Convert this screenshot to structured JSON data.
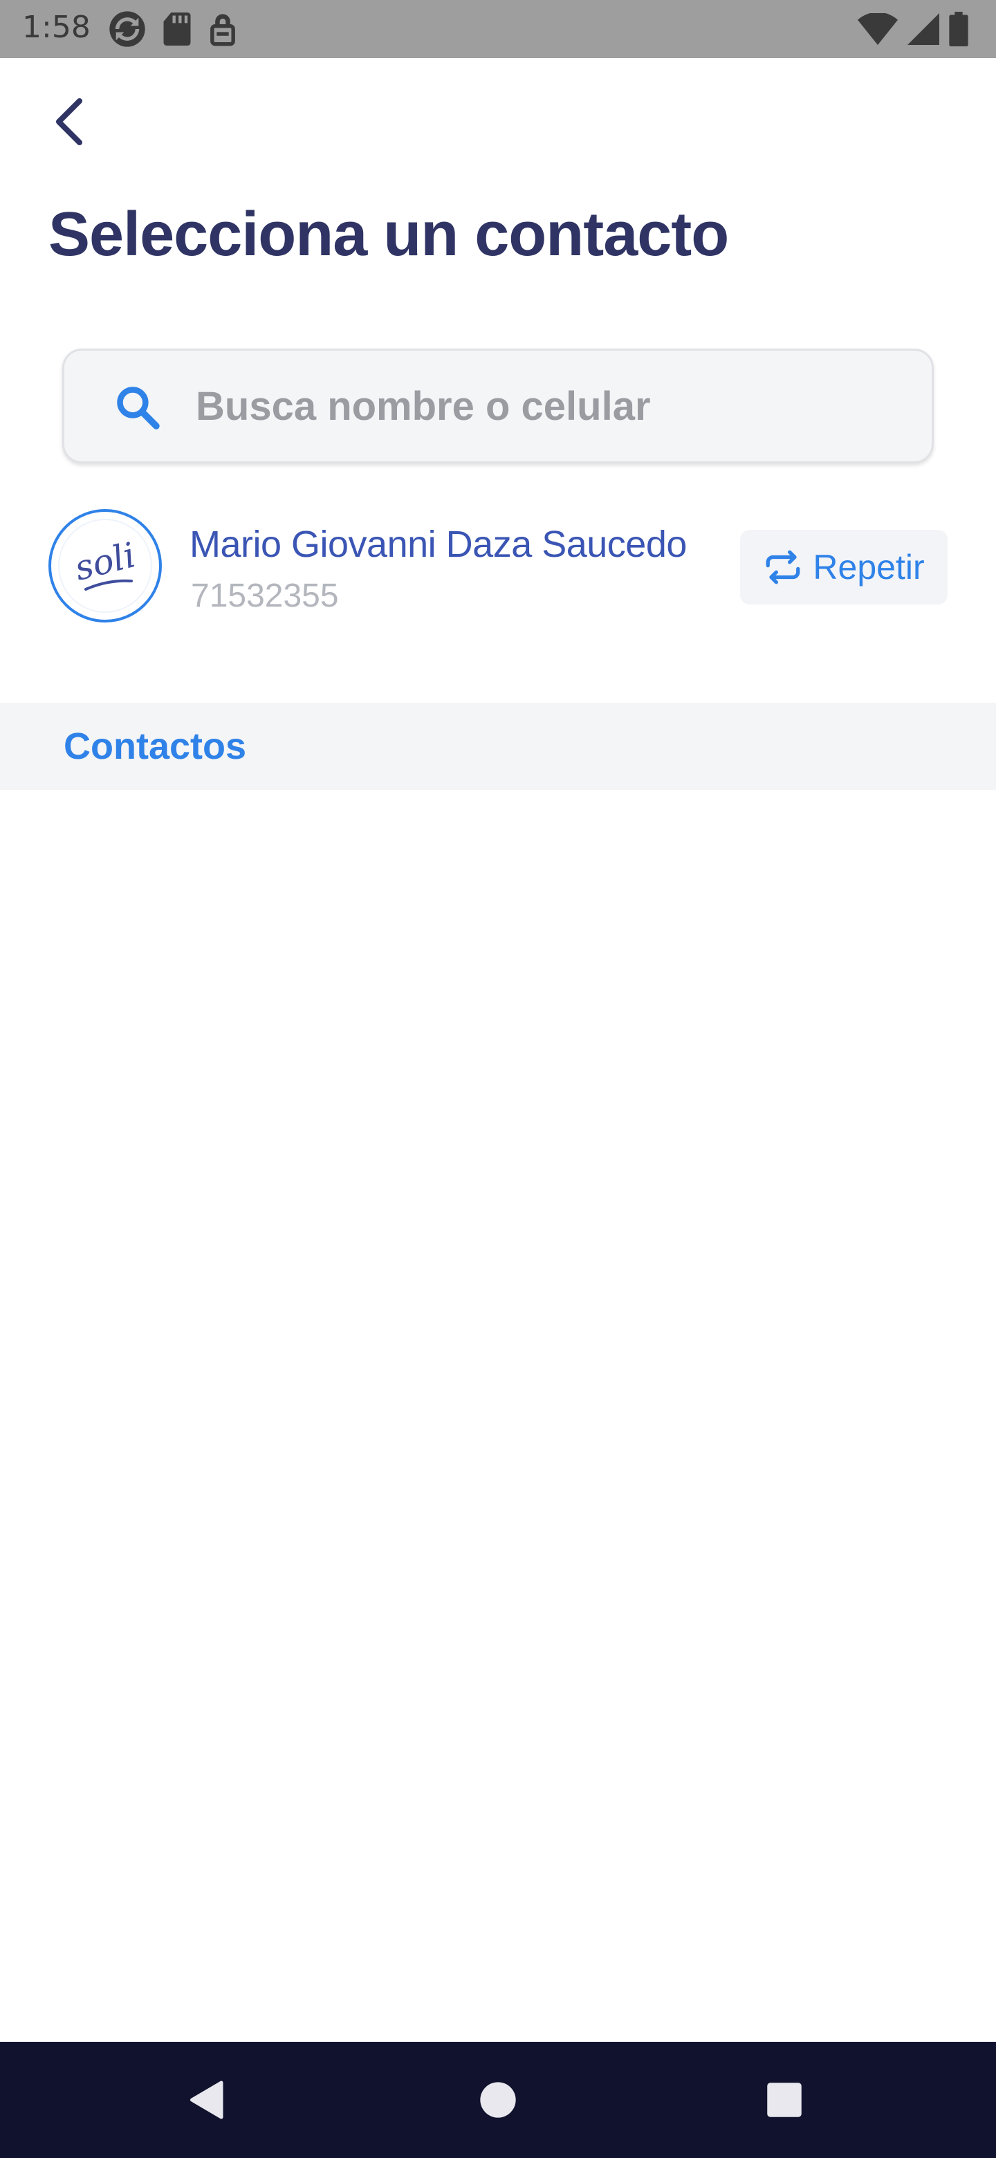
{
  "status_bar": {
    "time": "1:58",
    "left_icons": [
      "sync-icon",
      "sd-card-icon",
      "vpn-key-icon"
    ],
    "right_icons": [
      "wifi-icon",
      "cell-signal-icon",
      "battery-icon"
    ]
  },
  "header": {
    "back_icon": "chevron-left-icon",
    "title": "Selecciona un contacto"
  },
  "search": {
    "icon": "search-icon",
    "placeholder": "Busca nombre o celular",
    "value": ""
  },
  "recent_contacts": [
    {
      "avatar_text": "soli",
      "name": "Mario Giovanni Daza Saucedo",
      "phone": "71532355",
      "action_label": "Repetir",
      "action_icon": "repeat-icon"
    }
  ],
  "sections": {
    "contacts_label": "Contactos"
  },
  "nav_bar": {
    "items": [
      "back-triangle-icon",
      "home-circle-icon",
      "recents-square-icon"
    ]
  },
  "colors": {
    "status_bar": "#9e9e9e",
    "title": "#2f3464",
    "accent_blue": "#2f82e8",
    "contact_name": "#3a55b4",
    "muted_text": "#b3b6bd",
    "section_bg": "#f4f5f7",
    "nav_bar": "#11122e"
  }
}
